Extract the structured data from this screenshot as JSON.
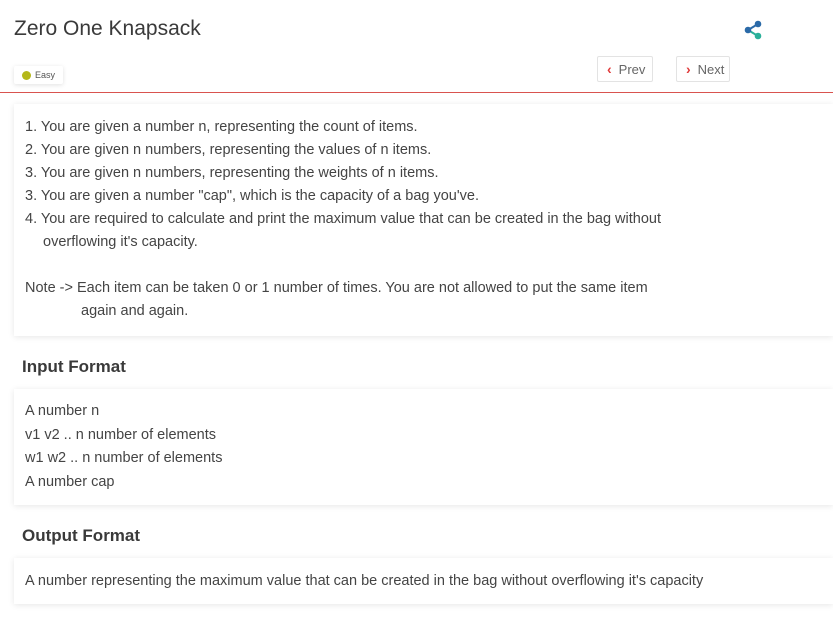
{
  "page": {
    "title": "Zero One Knapsack",
    "difficulty": "Easy",
    "nav": {
      "prev": "Prev",
      "next": "Next"
    },
    "colors": {
      "accent": "#e03a3a",
      "divider": "#d9534f",
      "difficulty_dot": "#b5b81a"
    }
  },
  "description": {
    "lines": [
      "1. You are given a number n, representing the count of items.",
      "2. You are given n numbers, representing the values of n items.",
      "3. You are given n numbers, representing the weights of n items.",
      "3. You are given a number \"cap\", which is the capacity of a bag you've.",
      "4. You are required to calculate and print the maximum value that can be created in the bag without",
      "overflowing it's capacity."
    ],
    "note": [
      "Note -> Each item can be taken 0 or 1 number of times. You are not allowed to put the same item",
      "again and again."
    ]
  },
  "input_format": {
    "heading": "Input Format",
    "lines": [
      "A number n",
      "v1 v2 .. n number of elements",
      "w1 w2 .. n number of elements",
      "A number cap"
    ]
  },
  "output_format": {
    "heading": "Output Format",
    "text": "A number representing the maximum value that can be created in the bag without overflowing it's capacity"
  }
}
